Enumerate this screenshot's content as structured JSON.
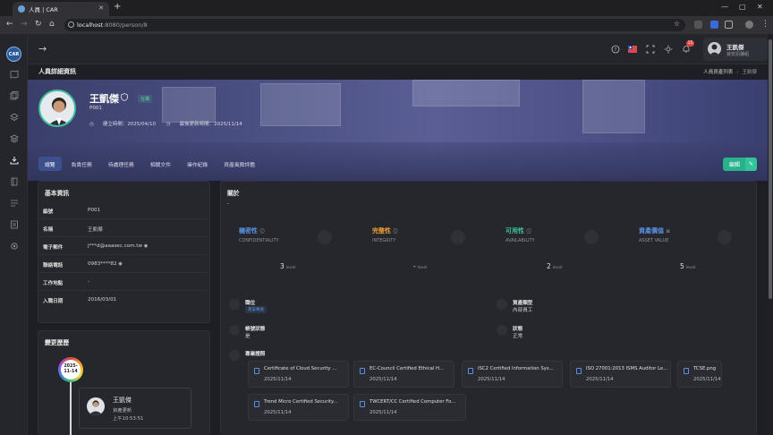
{
  "browser": {
    "tab_title": "人員 | CAR",
    "url_host": "localhost",
    "url_path": ":8080/person/8"
  },
  "sidebar": {
    "logo_text": "CAR",
    "icons": [
      "map-icon",
      "copy-icon",
      "layers-icon",
      "layers-stack-icon",
      "download-icon",
      "book-icon",
      "list-icon",
      "file-icon",
      "gear-icon"
    ]
  },
  "header": {
    "notification_count": "15",
    "user_name": "王凱傑",
    "user_role": "資安訊課組"
  },
  "page": {
    "title": "人員詳細資訊",
    "breadcrumb": [
      "人員資產列表",
      "王凱傑"
    ]
  },
  "profile": {
    "name": "王凱傑",
    "status": "在職",
    "code": "P001",
    "created": "建立時間：2025/04/10",
    "updated": "最後更新時間：2025/11/14"
  },
  "tabs": [
    "總覽",
    "負責任務",
    "待處理任務",
    "相關文件",
    "操作紀錄",
    "資產風險評鑑"
  ],
  "edit_label": "編輯",
  "basic_info": {
    "title": "基本資訊",
    "rows": [
      {
        "label": "編號",
        "value": "P001"
      },
      {
        "label": "名稱",
        "value": "王凱傑"
      },
      {
        "label": "電子郵件",
        "value": "j***d@aaasec.com.tw"
      },
      {
        "label": "聯絡電話",
        "value": "0983****82"
      },
      {
        "label": "工作地點",
        "value": "-"
      },
      {
        "label": "入職日期",
        "value": "2016/03/01"
      }
    ]
  },
  "history": {
    "title": "變更歷歷",
    "date": "2025-11-14",
    "card_name": "王凱傑",
    "card_action": "資產更新",
    "card_time": "上午10:53:51"
  },
  "about": {
    "title": "關於",
    "desc": "-",
    "cia": [
      {
        "name": "機密性",
        "en": "CONFIDENTIALITY",
        "level": "3",
        "unit": "level",
        "color": "#5b8fe0"
      },
      {
        "name": "完整性",
        "en": "INTEGRITY",
        "level": "-",
        "unit": "level",
        "color": "#f0a030"
      },
      {
        "name": "可用性",
        "en": "AVAILABILITY",
        "level": "2",
        "unit": "level",
        "color": "#3fc1a0"
      },
      {
        "name": "資產價值",
        "en": "ASSET VALUE",
        "level": "5",
        "unit": "level",
        "color": "#5b8fe0"
      }
    ],
    "fields": {
      "position_label": "職位",
      "position_value": "資安專員",
      "asset_type_label": "資產類型",
      "asset_type_value": "內部員工",
      "account_status_label": "帳號狀態",
      "account_status_value": "是",
      "status_label": "狀態",
      "status_value": "正常",
      "certs_label": "專業證照"
    },
    "certs": [
      {
        "name": "Certificate of Cloud Security ...",
        "date": "2025/11/14"
      },
      {
        "name": "EC-Council Certified Ethical H...",
        "date": "2025/11/14"
      },
      {
        "name": "ISC2 Certified Information Sys...",
        "date": "2025/11/14"
      },
      {
        "name": "ISO 27001:2013 ISMS Auditor Le...",
        "date": "2025/11/14"
      },
      {
        "name": "TCSE.png",
        "date": "2025/11/14"
      },
      {
        "name": "Trend Micro Certified Security...",
        "date": "2025/11/14"
      },
      {
        "name": "TWCERT/CC Certified Computer Fo...",
        "date": "2025/11/14"
      }
    ]
  }
}
